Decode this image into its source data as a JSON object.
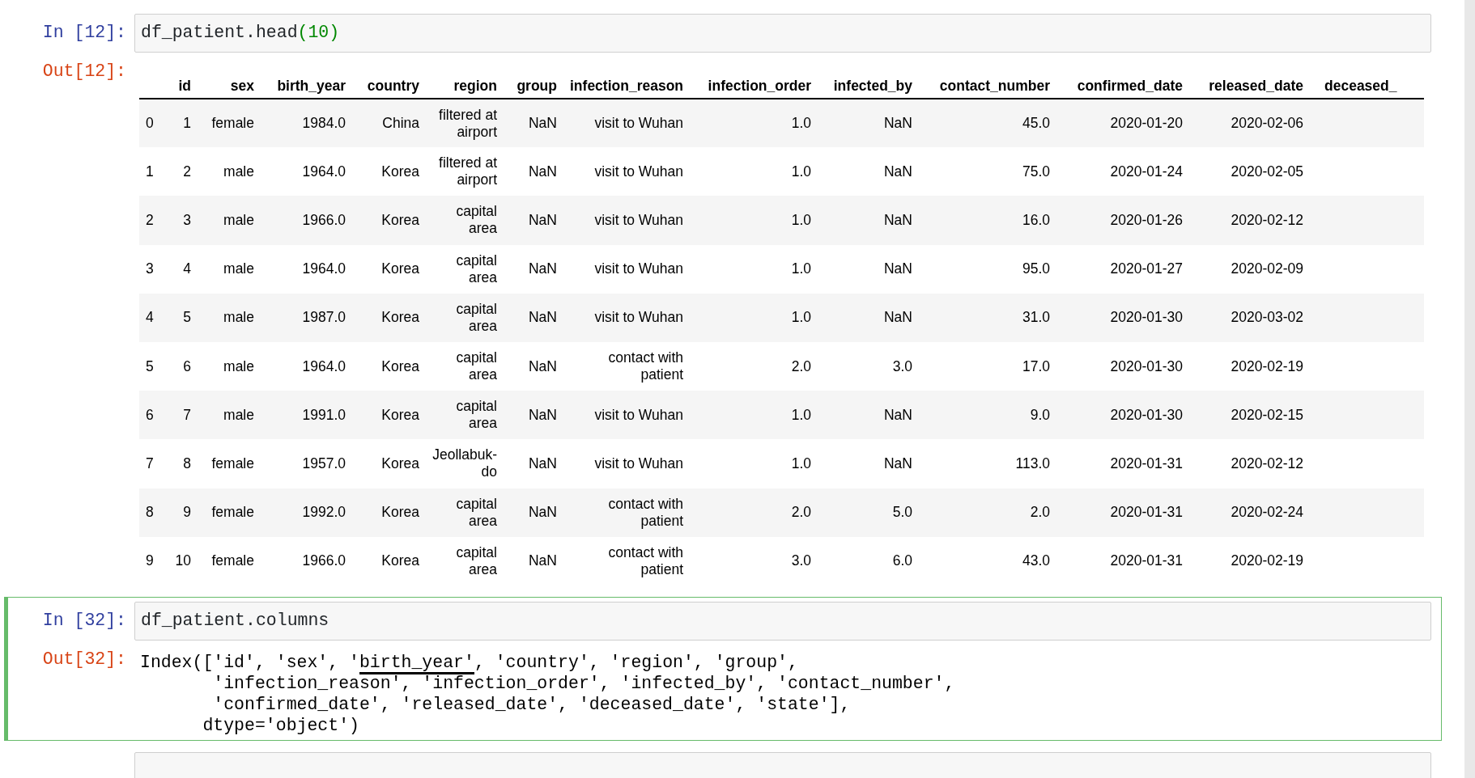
{
  "cells": [
    {
      "selected": false,
      "prompt_in": "In [12]:",
      "source": [
        {
          "kind": "name",
          "text": "df_patient.head"
        },
        {
          "kind": "number",
          "text": "(10)"
        }
      ],
      "prompt_out": "Out[12]:",
      "output": {
        "kind": "table",
        "columns": [
          "",
          "id",
          "sex",
          "birth_year",
          "country",
          "region",
          "group",
          "infection_reason",
          "infection_order",
          "infected_by",
          "contact_number",
          "confirmed_date",
          "released_date",
          "deceased_"
        ],
        "rows": [
          {
            "cells": [
              "0",
              "1",
              "female",
              "1984.0",
              "China",
              "filtered at airport",
              "NaN",
              "visit to Wuhan",
              "1.0",
              "NaN",
              "45.0",
              "2020-01-20",
              "2020-02-06"
            ]
          },
          {
            "cells": [
              "1",
              "2",
              "male",
              "1964.0",
              "Korea",
              "filtered at airport",
              "NaN",
              "visit to Wuhan",
              "1.0",
              "NaN",
              "75.0",
              "2020-01-24",
              "2020-02-05"
            ]
          },
          {
            "cells": [
              "2",
              "3",
              "male",
              "1966.0",
              "Korea",
              "capital area",
              "NaN",
              "visit to Wuhan",
              "1.0",
              "NaN",
              "16.0",
              "2020-01-26",
              "2020-02-12"
            ]
          },
          {
            "cells": [
              "3",
              "4",
              "male",
              "1964.0",
              "Korea",
              "capital area",
              "NaN",
              "visit to Wuhan",
              "1.0",
              "NaN",
              "95.0",
              "2020-01-27",
              "2020-02-09"
            ]
          },
          {
            "cells": [
              "4",
              "5",
              "male",
              "1987.0",
              "Korea",
              "capital area",
              "NaN",
              "visit to Wuhan",
              "1.0",
              "NaN",
              "31.0",
              "2020-01-30",
              "2020-03-02"
            ]
          },
          {
            "cells": [
              "5",
              "6",
              "male",
              "1964.0",
              "Korea",
              "capital area",
              "NaN",
              "contact with patient",
              "2.0",
              "3.0",
              "17.0",
              "2020-01-30",
              "2020-02-19"
            ]
          },
          {
            "cells": [
              "6",
              "7",
              "male",
              "1991.0",
              "Korea",
              "capital area",
              "NaN",
              "visit to Wuhan",
              "1.0",
              "NaN",
              "9.0",
              "2020-01-30",
              "2020-02-15"
            ]
          },
          {
            "cells": [
              "7",
              "8",
              "female",
              "1957.0",
              "Korea",
              "Jeollabuk-do",
              "NaN",
              "visit to Wuhan",
              "1.0",
              "NaN",
              "113.0",
              "2020-01-31",
              "2020-02-12"
            ]
          },
          {
            "cells": [
              "8",
              "9",
              "female",
              "1992.0",
              "Korea",
              "capital area",
              "NaN",
              "contact with patient",
              "2.0",
              "5.0",
              "2.0",
              "2020-01-31",
              "2020-02-24"
            ]
          },
          {
            "cells": [
              "9",
              "10",
              "female",
              "1966.0",
              "Korea",
              "capital area",
              "NaN",
              "contact with patient",
              "3.0",
              "6.0",
              "43.0",
              "2020-01-31",
              "2020-02-19"
            ]
          }
        ]
      }
    },
    {
      "selected": true,
      "prompt_in": "In [32]:",
      "source": [
        {
          "kind": "name",
          "text": "df_patient.columns"
        }
      ],
      "prompt_out": "Out[32]:",
      "output": {
        "kind": "text",
        "lines": [
          [
            {
              "text": "Index(['id', 'sex', '"
            },
            {
              "text": "birth_year'",
              "underlined": true
            },
            {
              "text": ", 'country', 'region', 'group',"
            }
          ],
          [
            {
              "text": "       'infection_reason', 'infection_order', 'infected_by', 'contact_number',"
            }
          ],
          [
            {
              "text": "       'confirmed_date', 'released_date', 'deceased_date', 'state'],"
            }
          ],
          [
            {
              "text": "      dtype='object')"
            }
          ]
        ]
      }
    },
    {
      "selected": false
    }
  ]
}
